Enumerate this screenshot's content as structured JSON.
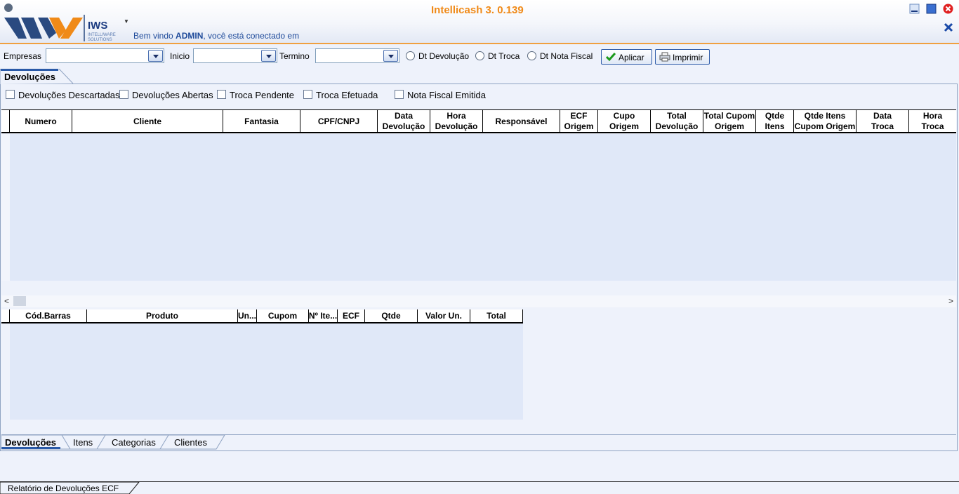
{
  "header": {
    "app_title": "Intellicash 3. 0.139",
    "logo_text": "IWS",
    "logo_sub1": "INTELLIWARE",
    "logo_sub2": "SOLUTIONS",
    "welcome_prefix": "Bem vindo ",
    "welcome_user": "ADMIN",
    "welcome_suffix": ", você está conectado em"
  },
  "filters": {
    "empresas_label": "Empresas",
    "inicio_label": "Inicio",
    "termino_label": "Termino",
    "empresas_value": "",
    "inicio_value": "",
    "termino_value": "",
    "radio_dt_devolucao": "Dt Devolução",
    "radio_dt_troca": "Dt Troca",
    "radio_dt_nota_fiscal": "Dt Nota Fiscal",
    "apply_label": "Aplicar",
    "print_label": "Imprimir"
  },
  "top_tab": "Devoluções",
  "checkboxes": [
    "Devoluções Descartadas",
    "Devoluções Abertas",
    "Troca Pendente",
    "Troca Efetuada",
    "Nota Fiscal Emitida"
  ],
  "grid_columns": [
    "Numero",
    "Cliente",
    "Fantasia",
    "CPF/CNPJ",
    "Data\nDevolução",
    "Hora\nDevolução",
    "Responsável",
    "ECF\nOrigem",
    "Cupo\nOrigem",
    "Total\nDevolução",
    "Total Cupom\nOrigem",
    "Qtde\nItens",
    "Qtde Itens\nCupom Origem",
    "Data\nTroca",
    "Hora\nTroca"
  ],
  "items_columns": [
    "Cód.Barras",
    "Produto",
    "Un...",
    "Cupom",
    "Nº Ite...",
    "ECF",
    "Qtde",
    "Valor Un.",
    "Total"
  ],
  "bottom_tabs": [
    "Devoluções",
    "Itens",
    "Categorias",
    "Clientes"
  ],
  "footer_tab": "Relatório de Devoluções ECF",
  "colors": {
    "accent": "#f08a18",
    "brand_blue": "#1e4a9a",
    "grid_bg": "#e0e8f8"
  }
}
